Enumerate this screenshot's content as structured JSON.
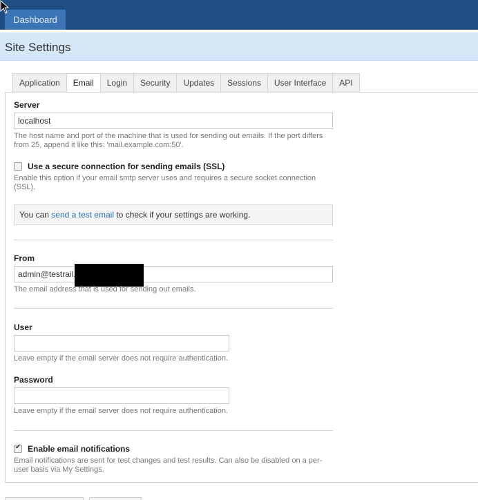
{
  "topbar": {
    "dashboard_tab": "Dashboard"
  },
  "page": {
    "title": "Site Settings"
  },
  "tabs": [
    {
      "label": "Application"
    },
    {
      "label": "Email"
    },
    {
      "label": "Login"
    },
    {
      "label": "Security"
    },
    {
      "label": "Updates"
    },
    {
      "label": "Sessions"
    },
    {
      "label": "User Interface"
    },
    {
      "label": "API"
    }
  ],
  "active_tab": "Email",
  "server": {
    "label": "Server",
    "value": "localhost",
    "help": "The host name and port of the machine that is used for sending out emails. If the port differs from 25, append it like this: 'mail.example.com:50'."
  },
  "ssl": {
    "label": "Use a secure connection for sending emails (SSL)",
    "checked": false,
    "help": "Enable this option if your email smtp server uses and requires a secure socket connection (SSL)."
  },
  "test_notice": {
    "prefix": "You can ",
    "link": "send a test email",
    "suffix": " to check if your settings are working."
  },
  "from": {
    "label": "From",
    "value": "admin@testrail.",
    "help": "The email address that is used for sending out emails."
  },
  "user": {
    "label": "User",
    "value": "",
    "help": "Leave empty if the email server does not require authentication."
  },
  "password": {
    "label": "Password",
    "value": "",
    "help": "Leave empty if the email server does not require authentication."
  },
  "notifications": {
    "label": "Enable email notifications",
    "checked": true,
    "help": "Email notifications are sent for test changes and test results. Can also be disabled on a per-user basis via My Settings."
  }
}
